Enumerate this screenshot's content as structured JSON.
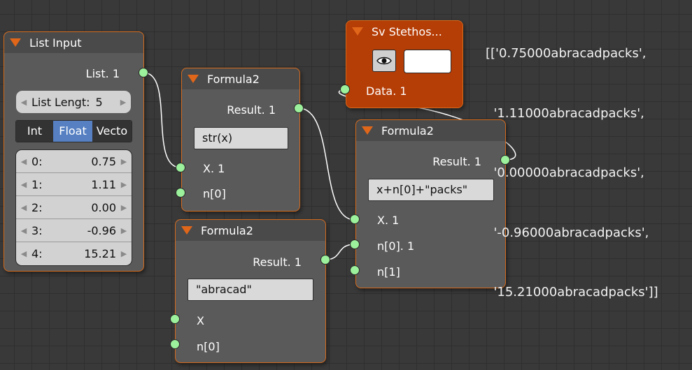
{
  "nodes": {
    "list_input": {
      "title": "List Input",
      "output_label": "List. 1",
      "list_length": {
        "label": "List Lengt:",
        "value": "5"
      },
      "type_tabs": [
        "Int",
        "Float",
        "Vecto"
      ],
      "active_tab": "Float",
      "items": [
        {
          "index": "0:",
          "value": "0.75"
        },
        {
          "index": "1:",
          "value": "1.11"
        },
        {
          "index": "2:",
          "value": "0.00"
        },
        {
          "index": "3:",
          "value": "-0.96"
        },
        {
          "index": "4:",
          "value": "15.21"
        }
      ]
    },
    "formula_a": {
      "title": "Formula2",
      "output_label": "Result. 1",
      "formula": "str(x)",
      "inputs": [
        "X. 1",
        "n[0]"
      ]
    },
    "formula_b": {
      "title": "Formula2",
      "output_label": "Result. 1",
      "formula": "\"abracad\"",
      "inputs": [
        "X",
        "n[0]"
      ]
    },
    "formula_c": {
      "title": "Formula2",
      "output_label": "Result. 1",
      "formula": "x+n[0]+\"packs\"",
      "inputs": [
        "X. 1",
        "n[0]. 1",
        "n[1]"
      ]
    },
    "stethoscope": {
      "title": "Sv Stethos...",
      "input_label": "Data. 1",
      "eye_icon": "eye-icon",
      "swatch_color": "#ffffff"
    }
  },
  "console_output": [
    "[['0.75000abracadpacks',",
    "  '1.11000abracadpacks',",
    "  '0.00000abracadpacks',",
    "  '-0.96000abracadpacks',",
    "  '15.21000abracadpacks']]"
  ],
  "colors": {
    "background": "#393939",
    "node_body": "#5a5a5a",
    "node_header": "#4a4a4a",
    "node_border": "#d56a1c",
    "socket": "#9cf19c",
    "stethoscope": "#b53d06",
    "active_tab": "#5680c2",
    "wire": "#ffffff"
  }
}
